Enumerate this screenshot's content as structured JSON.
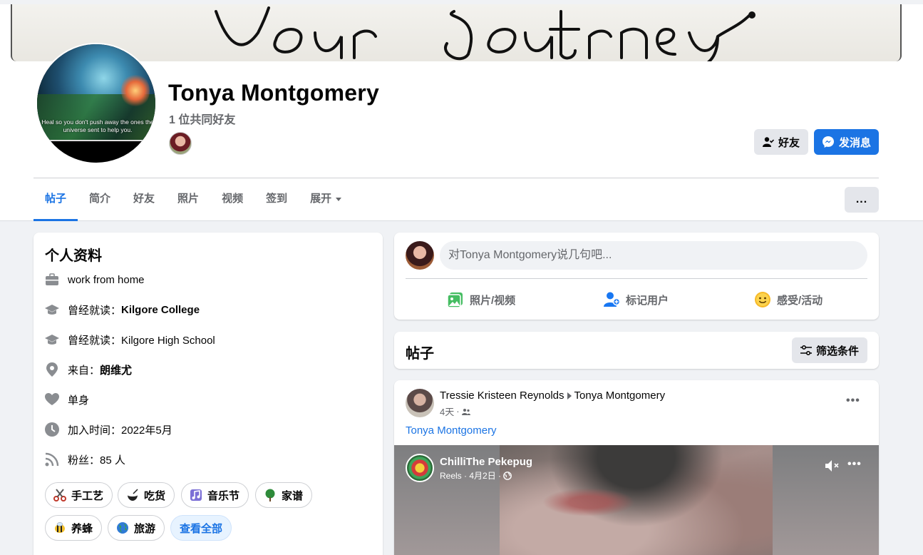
{
  "profile": {
    "name": "Tonya Montgomery",
    "mutual_friends": "1 位共同好友",
    "picture_quote": "Heal so you don't push away the ones the universe sent to help you.",
    "cover_text": "Your Journey"
  },
  "actions": {
    "friends_label": "好友",
    "message_label": "发消息"
  },
  "tabs": [
    {
      "label": "帖子",
      "active": true
    },
    {
      "label": "简介"
    },
    {
      "label": "好友"
    },
    {
      "label": "照片"
    },
    {
      "label": "视频"
    },
    {
      "label": "签到"
    },
    {
      "label": "展开"
    }
  ],
  "tab_more": "...",
  "intro": {
    "title": "个人资料",
    "work": "work from home",
    "college_prefix": "曾经就读：",
    "college": "Kilgore College",
    "high_school": "曾经就读：Kilgore High School",
    "from_prefix": "来自：",
    "from": "朗维尤",
    "relationship": "单身",
    "joined": "加入时间：2022年5月",
    "followers_prefix": "粉丝：",
    "followers": "85 人",
    "hobbies": [
      {
        "label": "手工艺",
        "icon": "scissors-icon"
      },
      {
        "label": "吃货",
        "icon": "food-icon"
      },
      {
        "label": "音乐节",
        "icon": "music-icon"
      },
      {
        "label": "家谱",
        "icon": "tree-icon"
      },
      {
        "label": "养蜂",
        "icon": "bee-icon"
      },
      {
        "label": "旅游",
        "icon": "globe-icon"
      }
    ],
    "see_all": "查看全部"
  },
  "composer": {
    "placeholder": "对Tonya Montgomery说几句吧...",
    "photo_video": "照片/视频",
    "tag_people": "标记用户",
    "feeling": "感受/活动"
  },
  "posts": {
    "title": "帖子",
    "filter_label": "筛选条件",
    "items": [
      {
        "author": "Tressie Kristeen Reynolds",
        "target": "Tonya Montgomery",
        "time": "4天",
        "link": "Tonya Montgomery",
        "reel": {
          "name": "ChilliThe Pekepug",
          "meta": "Reels · 4月2日 ·"
        }
      }
    ]
  },
  "colors": {
    "accent": "#1b74e4",
    "secondary_text": "#65676b",
    "button_grey": "#e4e6eb",
    "page_bg": "#f0f2f5"
  }
}
